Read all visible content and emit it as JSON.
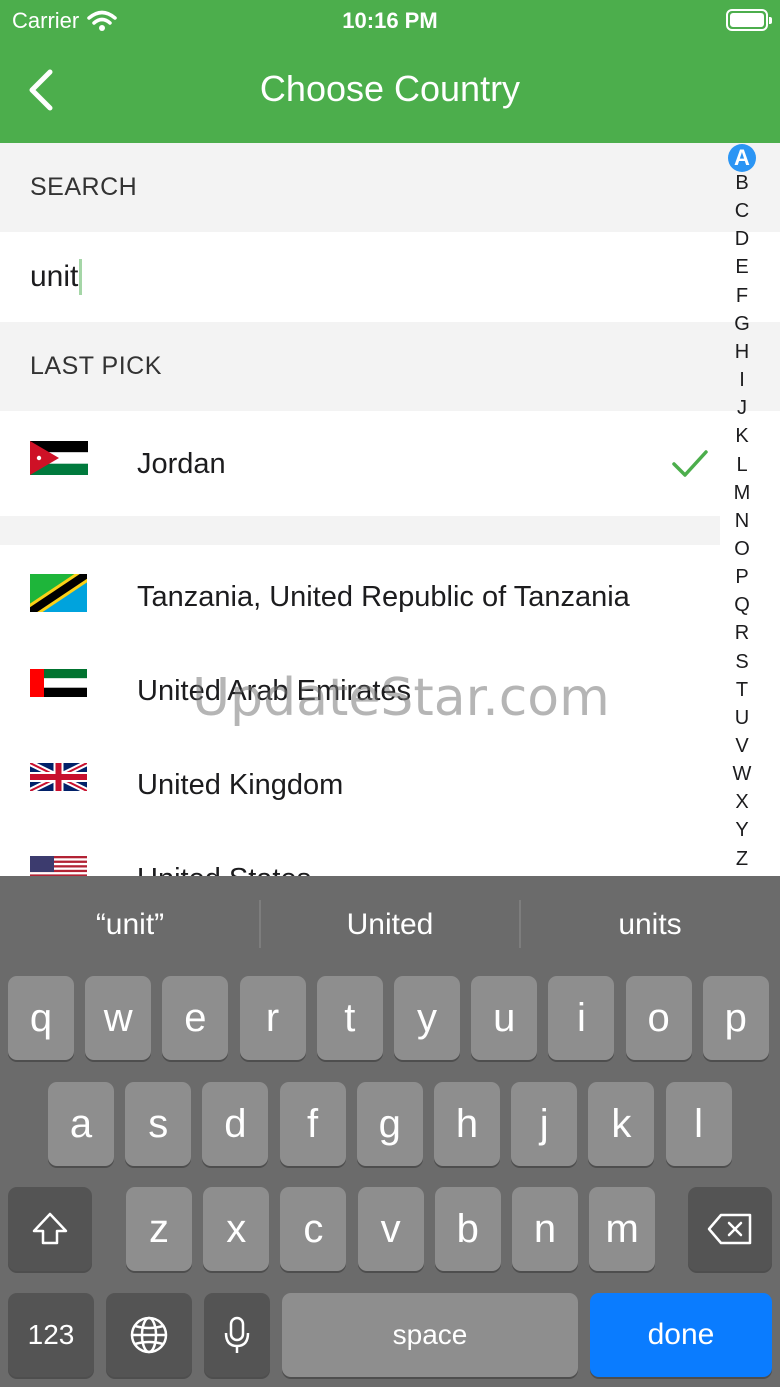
{
  "status_bar": {
    "carrier": "Carrier",
    "time": "10:16 PM"
  },
  "nav": {
    "title": "Choose Country",
    "back_icon": "chevron-left-icon"
  },
  "search": {
    "header": "SEARCH",
    "value": "unit"
  },
  "last_pick": {
    "header": "LAST PICK",
    "country": "Jordan",
    "selected": true
  },
  "results": [
    {
      "name": "Tanzania, United Republic of Tanzania",
      "flag": "tanzania-flag-icon"
    },
    {
      "name": "United Arab Emirates",
      "flag": "uae-flag-icon"
    },
    {
      "name": "United Kingdom",
      "flag": "uk-flag-icon"
    },
    {
      "name": "United States",
      "flag": "us-flag-icon"
    }
  ],
  "alphabet_index": {
    "letters": [
      "A",
      "B",
      "C",
      "D",
      "E",
      "F",
      "G",
      "H",
      "I",
      "J",
      "K",
      "L",
      "M",
      "N",
      "O",
      "P",
      "Q",
      "R",
      "S",
      "T",
      "U",
      "V",
      "W",
      "X",
      "Y",
      "Z"
    ],
    "active": "A"
  },
  "watermark": "UpdateStar.com",
  "keyboard": {
    "suggestions": [
      "“unit”",
      "United",
      "units"
    ],
    "row1": [
      "q",
      "w",
      "e",
      "r",
      "t",
      "y",
      "u",
      "i",
      "o",
      "p"
    ],
    "row2": [
      "a",
      "s",
      "d",
      "f",
      "g",
      "h",
      "j",
      "k",
      "l"
    ],
    "row3": [
      "z",
      "x",
      "c",
      "v",
      "b",
      "n",
      "m"
    ],
    "numbers_label": "123",
    "space_label": "space",
    "done_label": "done"
  },
  "colors": {
    "accent": "#4cae4c",
    "index_active": "#2b95f4",
    "done_key": "#0a7cff"
  }
}
